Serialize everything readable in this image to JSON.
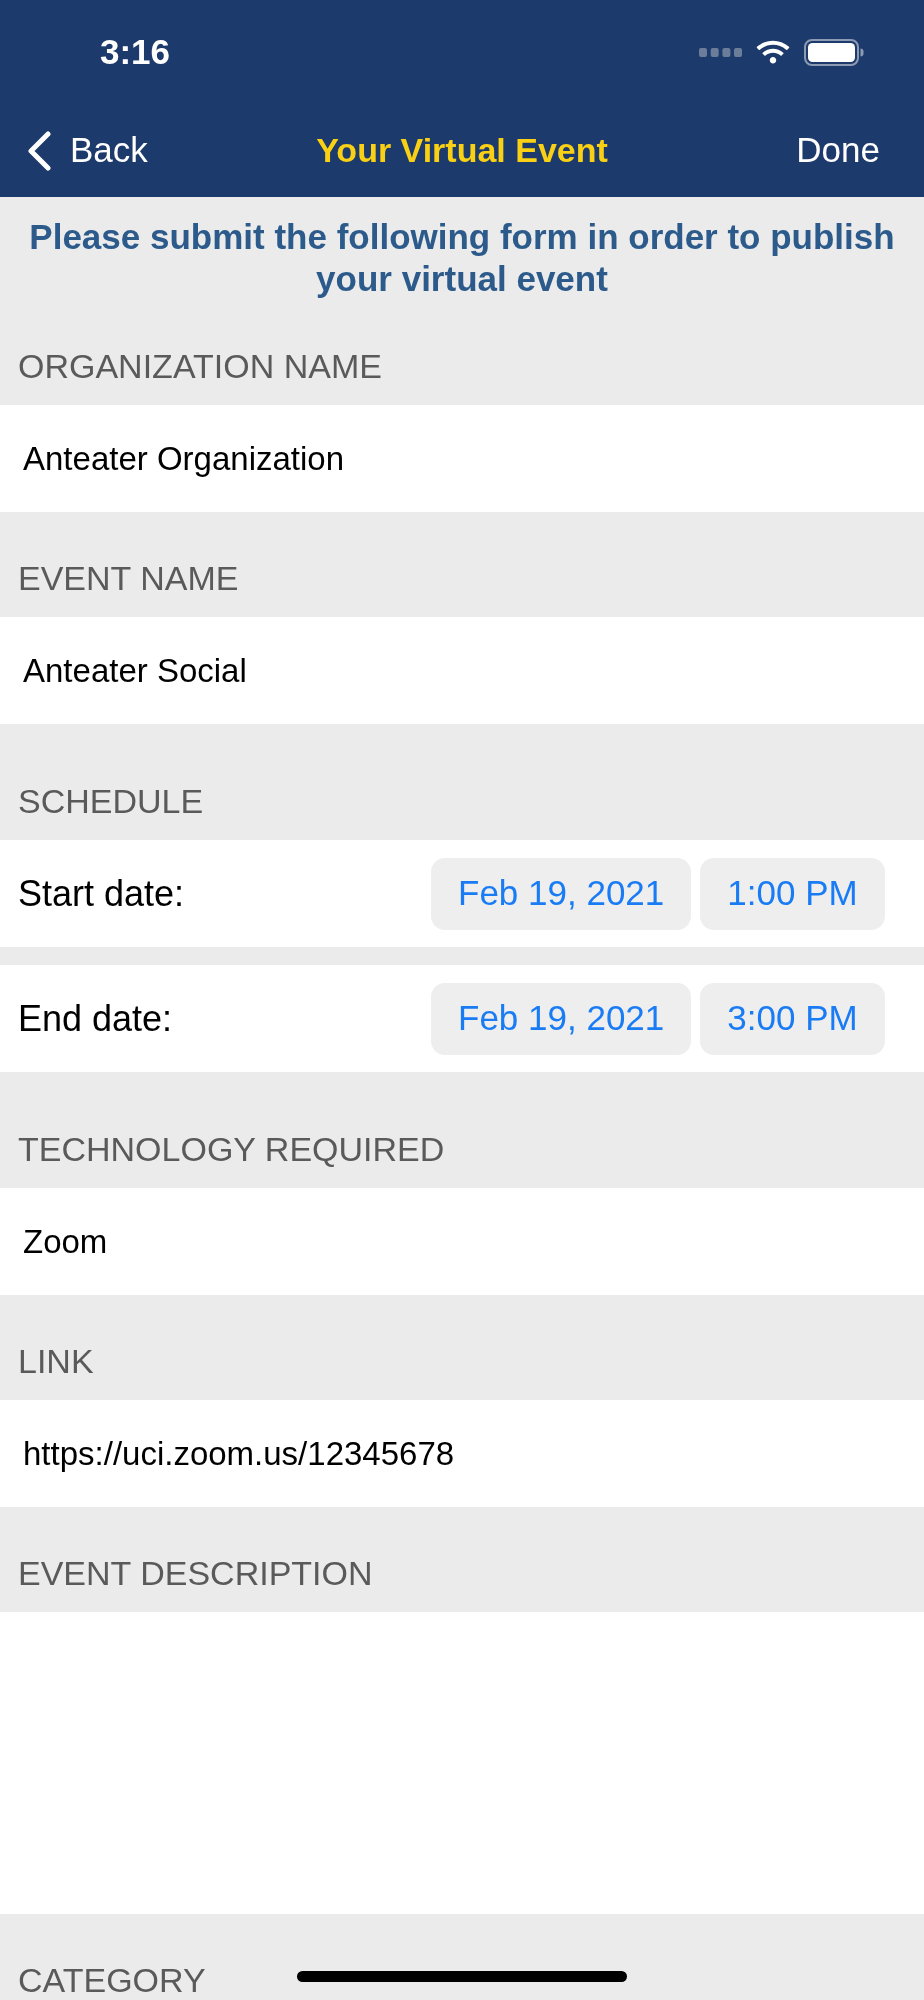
{
  "status_bar": {
    "time": "3:16"
  },
  "nav_bar": {
    "back_label": "Back",
    "title": "Your Virtual Event",
    "done_label": "Done"
  },
  "instructions": "Please submit the following form in order to publish your virtual event",
  "sections": [
    {
      "header": "ORGANIZATION NAME",
      "kind": "text",
      "value": "Anteater Organization"
    },
    {
      "header": "EVENT NAME",
      "kind": "text",
      "value": "Anteater Social"
    },
    {
      "header": "SCHEDULE",
      "kind": "dates",
      "rows": [
        {
          "label": "Start date:",
          "date": "Feb 19, 2021",
          "time": "1:00 PM"
        },
        {
          "label": "End date:",
          "date": "Feb 19, 2021",
          "time": "3:00 PM"
        }
      ]
    },
    {
      "header": "TECHNOLOGY REQUIRED",
      "kind": "text",
      "value": "Zoom"
    },
    {
      "header": "LINK",
      "kind": "text",
      "value": "https://uci.zoom.us/12345678"
    },
    {
      "header": "EVENT DESCRIPTION",
      "kind": "textarea"
    },
    {
      "header": "CATEGORY"
    }
  ]
}
